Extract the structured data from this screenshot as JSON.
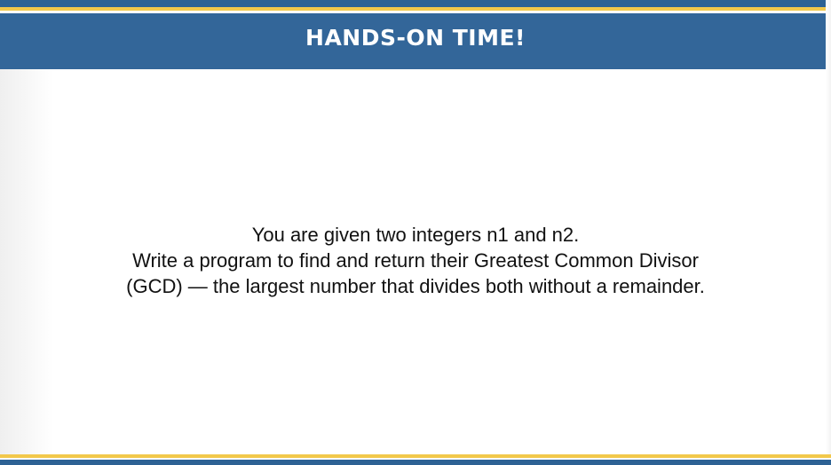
{
  "header": {
    "title": "HANDS-ON TIME!"
  },
  "content": {
    "lines": [
      "You are given two integers n1 and n2.",
      "Write a program to find and return their Greatest Common Divisor",
      "(GCD) — the largest number that divides both without a remainder."
    ]
  },
  "colors": {
    "header_blue": "#336699",
    "stripe_dark_blue": "#2d6294",
    "stripe_gold": "#f2c84b",
    "text": "#111111"
  }
}
